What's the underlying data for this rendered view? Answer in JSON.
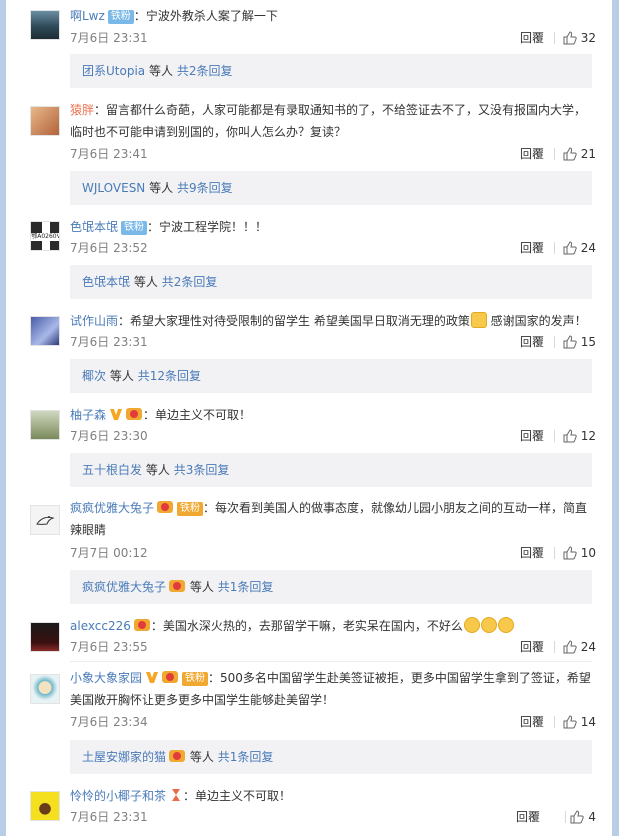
{
  "labels": {
    "reply": "回覆",
    "and_others": "等人"
  },
  "comments": [
    {
      "user": "啊Lwz",
      "badge": "铁粉",
      "text": "：宁波外教杀人案了解一下",
      "time": "7月6日 23:31",
      "likes": "32",
      "sub_user": "团系Utopia",
      "sub_count": "共2条回复"
    },
    {
      "user": "猿胖",
      "text": "：留言都什么奇葩，人家可能都是有录取通知书的了，不给签证去不了，又没有报国内大学，临时也不可能申请到别国的，你叫人怎么办？复读？",
      "time": "7月6日 23:41",
      "likes": "21",
      "sub_user": "WJLOVESN",
      "sub_count": "共9条回复"
    },
    {
      "user": "色氓本氓",
      "badge": "铁粉",
      "text": "：宁波工程学院！！！",
      "time": "7月6日 23:52",
      "likes": "24",
      "sub_user": "色氓本氓",
      "sub_count": "共2条回复",
      "avatar_text": "鄂A0260V"
    },
    {
      "user": "试作山雨",
      "text": "：希望大家理性对待受限制的留学生 希望美国早日取消无理的政策",
      "text2": " 感谢国家的发声！",
      "time": "7月6日 23:31",
      "likes": "15",
      "sub_user": "椰次",
      "sub_count": "共12条回复"
    },
    {
      "user": "柚子森",
      "text": "：单边主义不可取！",
      "time": "7月6日 23:30",
      "likes": "12",
      "sub_user": "五十根白发",
      "sub_count": "共3条回复"
    },
    {
      "user": "疯疯优雅大兔子",
      "badge": "铁粉",
      "text": "：每次看到美国人的做事态度，就像幼儿园小朋友之间的互动一样，简直辣眼睛",
      "time": "7月7日 00:12",
      "likes": "10",
      "sub_user": "疯疯优雅大兔子",
      "sub_count": "共1条回复"
    },
    {
      "user": "alexcc226",
      "text": "：美国水深火热的，去那留学干嘛，老实呆在国内，不好么",
      "time": "7月6日 23:55",
      "likes": "24"
    },
    {
      "user": "小象大象家园",
      "badge": "铁粉",
      "text": "：500多名中国留学生赴美签证被拒，更多中国留学生拿到了签证，希望美国敞开胸怀让更多更多中国学生能够赴美留学！",
      "time": "7月6日 23:34",
      "likes": "14",
      "sub_user": "土屋安娜家的猫",
      "sub_count": "共1条回复"
    },
    {
      "user": "怜怜的小椰子和茶",
      "text": "：单边主义不可取！",
      "time": "7月6日 23:31",
      "likes": "4"
    }
  ]
}
